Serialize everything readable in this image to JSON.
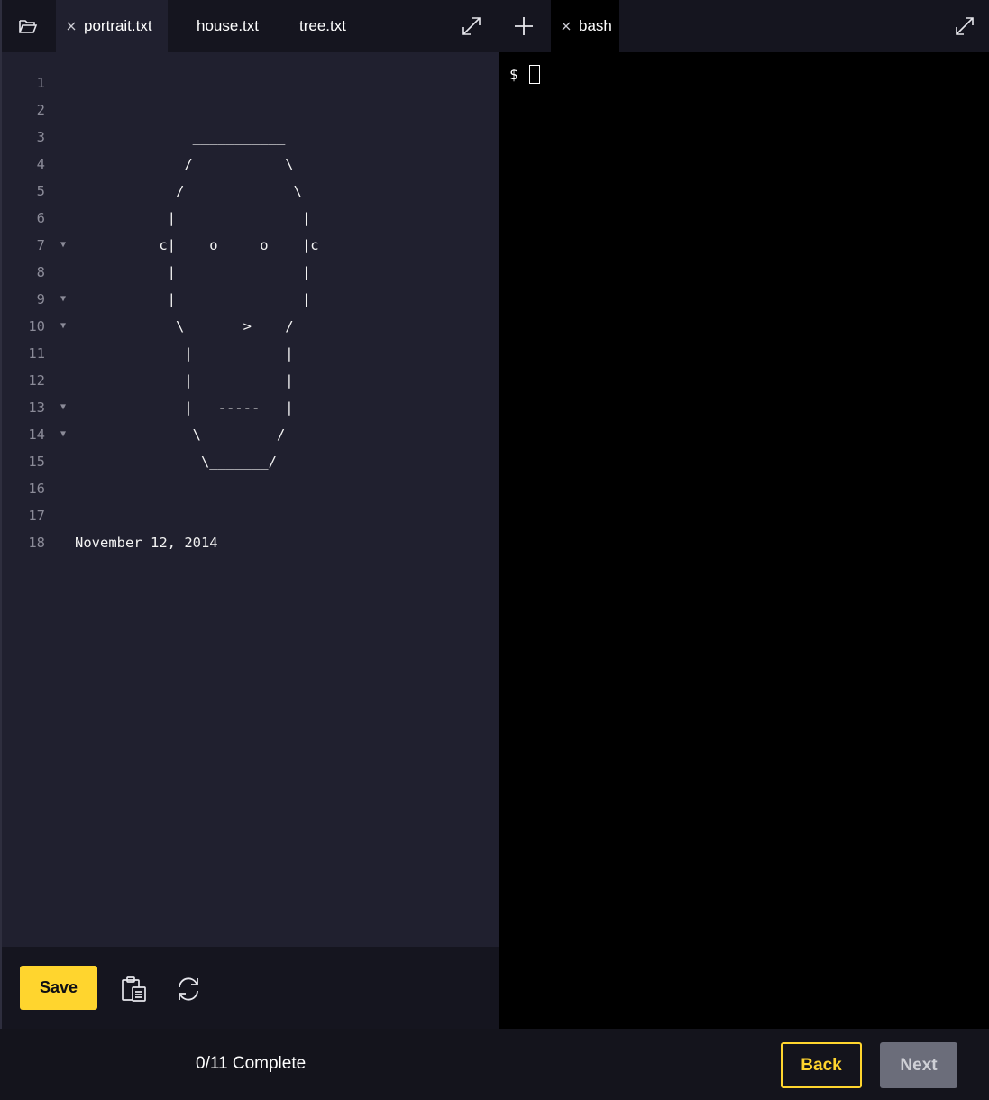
{
  "editor": {
    "tabs": [
      {
        "label": "portrait.txt",
        "active": true,
        "closable": true
      },
      {
        "label": "house.txt",
        "active": false,
        "closable": false
      },
      {
        "label": "tree.txt",
        "active": false,
        "closable": false
      }
    ],
    "lines": [
      {
        "num": "1",
        "text": "",
        "fold": false
      },
      {
        "num": "2",
        "text": "",
        "fold": false
      },
      {
        "num": "3",
        "text": "              ___________",
        "fold": false
      },
      {
        "num": "4",
        "text": "             /           \\",
        "fold": false
      },
      {
        "num": "5",
        "text": "            /             \\",
        "fold": false
      },
      {
        "num": "6",
        "text": "           |               |",
        "fold": false
      },
      {
        "num": "7",
        "text": "          c|    o     o    |c",
        "fold": true
      },
      {
        "num": "8",
        "text": "           |               |",
        "fold": false
      },
      {
        "num": "9",
        "text": "           |               |",
        "fold": true
      },
      {
        "num": "10",
        "text": "            \\       >    /",
        "fold": true
      },
      {
        "num": "11",
        "text": "             |           |",
        "fold": false
      },
      {
        "num": "12",
        "text": "             |           |",
        "fold": false
      },
      {
        "num": "13",
        "text": "             |   -----   |",
        "fold": true
      },
      {
        "num": "14",
        "text": "              \\         /",
        "fold": true
      },
      {
        "num": "15",
        "text": "               \\_______/",
        "fold": false
      },
      {
        "num": "16",
        "text": "",
        "fold": false
      },
      {
        "num": "17",
        "text": "",
        "fold": false
      },
      {
        "num": "18",
        "text": "November 12, 2014",
        "fold": false
      }
    ],
    "toolbar": {
      "save_label": "Save"
    }
  },
  "terminal": {
    "tab_label": "bash",
    "prompt": "$"
  },
  "footer": {
    "progress": "0/11 Complete",
    "back_label": "Back",
    "next_label": "Next"
  },
  "colors": {
    "accent": "#ffd52e",
    "editor_bg": "#20202f",
    "tabbar_bg": "#15151f",
    "terminal_bg": "#000000",
    "next_disabled": "#6b6d7a"
  }
}
